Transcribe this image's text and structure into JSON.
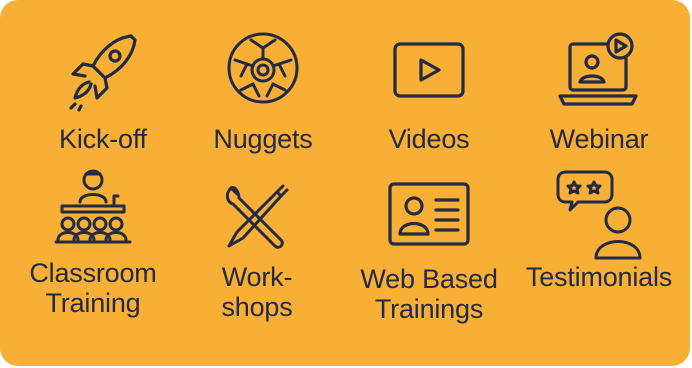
{
  "colors": {
    "panel": "#F8AF36",
    "ink": "#222a44"
  },
  "tiles": [
    {
      "icon": "rocket-icon",
      "lines": [
        "Kick-off"
      ]
    },
    {
      "icon": "nuggets-icon",
      "lines": [
        "Nuggets"
      ]
    },
    {
      "icon": "video-play-icon",
      "lines": [
        "Videos"
      ]
    },
    {
      "icon": "webinar-laptop-icon",
      "lines": [
        "Webinar"
      ]
    },
    {
      "icon": "classroom-icon",
      "lines": [
        "Classroom",
        "Training"
      ]
    },
    {
      "icon": "tools-icon",
      "lines": [
        "Work-",
        "shops"
      ]
    },
    {
      "icon": "id-card-icon",
      "lines": [
        "Web Based",
        "Trainings"
      ]
    },
    {
      "icon": "testimonial-icon",
      "lines": [
        "Testimonials"
      ]
    }
  ]
}
